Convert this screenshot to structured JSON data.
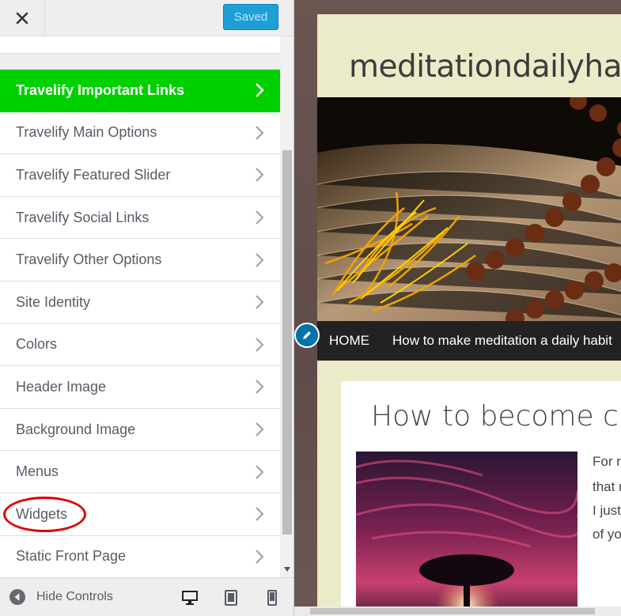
{
  "header": {
    "close_icon": "close-icon",
    "saved_label": "Saved"
  },
  "menu": {
    "items": [
      {
        "label": "Travelify Important Links",
        "active": true
      },
      {
        "label": "Travelify Main Options"
      },
      {
        "label": "Travelify Featured Slider"
      },
      {
        "label": "Travelify Social Links"
      },
      {
        "label": "Travelify Other Options"
      },
      {
        "label": "Site Identity"
      },
      {
        "label": "Colors"
      },
      {
        "label": "Header Image"
      },
      {
        "label": "Background Image"
      },
      {
        "label": "Menus"
      },
      {
        "label": "Widgets",
        "highlighted": true
      },
      {
        "label": "Static Front Page"
      }
    ]
  },
  "footer": {
    "hide_controls_label": "Hide Controls",
    "devices": [
      "desktop-icon",
      "tablet-icon",
      "mobile-icon"
    ]
  },
  "preview": {
    "site_title": "meditationdailyhab",
    "nav": {
      "home": "HOME",
      "link": "How to make meditation a daily habit"
    },
    "post": {
      "title": "How to become cre",
      "excerpt": [
        "For r",
        "that r",
        "I just",
        "of yo"
      ]
    }
  },
  "colors": {
    "accent": "#00d000",
    "saved_button": "#1e9fd8",
    "highlight_ring": "#e00000"
  }
}
